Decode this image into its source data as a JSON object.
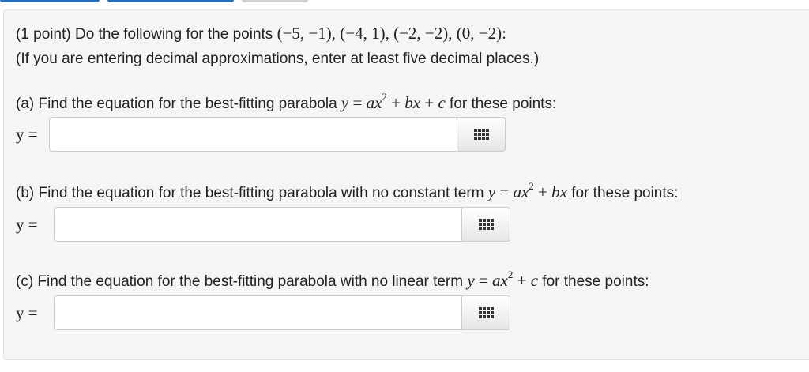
{
  "intro": {
    "line1_prefix": "(1 point) Do the following for the points ",
    "points": "(−5, −1), (−4, 1), (−2, −2), (0, −2):",
    "line2": "(If you are entering decimal approximations, enter at least five decimal places.)"
  },
  "parts": [
    {
      "prefix": "(a) Find the equation for the best-fitting parabola ",
      "suffix": " for these points:",
      "answer_label": "y =",
      "answer_value": "",
      "button_icon": "equation-editor-icon"
    },
    {
      "prefix": "(b) Find the equation for the best-fitting parabola with no constant term ",
      "suffix": " for these points:",
      "answer_label": "y =",
      "answer_value": "",
      "button_icon": "equation-editor-icon"
    },
    {
      "prefix": "(c) Find the equation for the best-fitting parabola with no linear term ",
      "suffix": " for these points:",
      "answer_label": "y =",
      "answer_value": "",
      "button_icon": "equation-editor-icon"
    }
  ],
  "colors": {
    "tab_blue": "#2a6fb5",
    "tab_gray": "#d0d0d0",
    "panel_bg": "#f5f5f5"
  }
}
